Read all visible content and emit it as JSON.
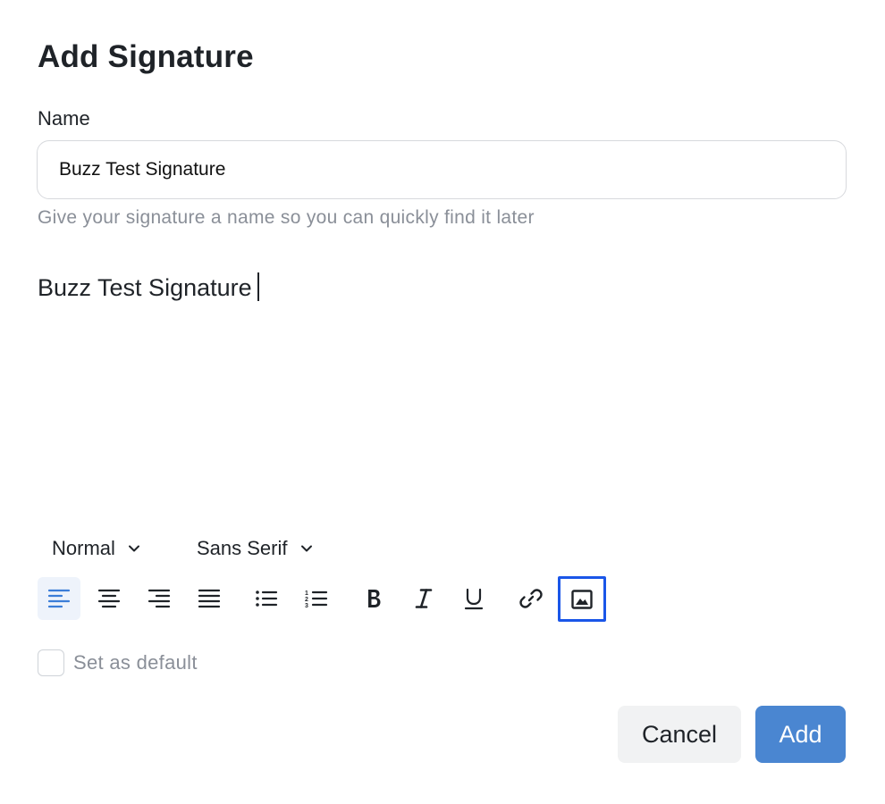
{
  "dialog": {
    "title": "Add Signature",
    "name_label": "Name",
    "name_value": "Buzz Test Signature",
    "helper_text": "Give your signature a name so you can quickly find it later"
  },
  "editor": {
    "content": "Buzz Test Signature"
  },
  "toolbar": {
    "size_select": "Normal",
    "font_select": "Sans Serif",
    "buttons": [
      {
        "name": "align-left",
        "icon": "align-left-icon",
        "active": true
      },
      {
        "name": "align-center",
        "icon": "align-center-icon"
      },
      {
        "name": "align-right",
        "icon": "align-right-icon"
      },
      {
        "name": "align-justify",
        "icon": "align-justify-icon"
      },
      {
        "name": "bullet-list",
        "icon": "bullet-list-icon"
      },
      {
        "name": "numbered-list",
        "icon": "numbered-list-icon"
      },
      {
        "name": "bold",
        "icon": "bold-icon"
      },
      {
        "name": "italic",
        "icon": "italic-icon"
      },
      {
        "name": "underline",
        "icon": "underline-icon"
      },
      {
        "name": "link",
        "icon": "link-icon"
      },
      {
        "name": "image",
        "icon": "image-icon",
        "focused": true
      }
    ],
    "active_color": "#3b7dd8",
    "focus_color": "#1a56e8"
  },
  "options": {
    "default_label": "Set as default",
    "default_checked": false
  },
  "actions": {
    "cancel_label": "Cancel",
    "add_label": "Add",
    "add_color": "#4a86d1"
  }
}
